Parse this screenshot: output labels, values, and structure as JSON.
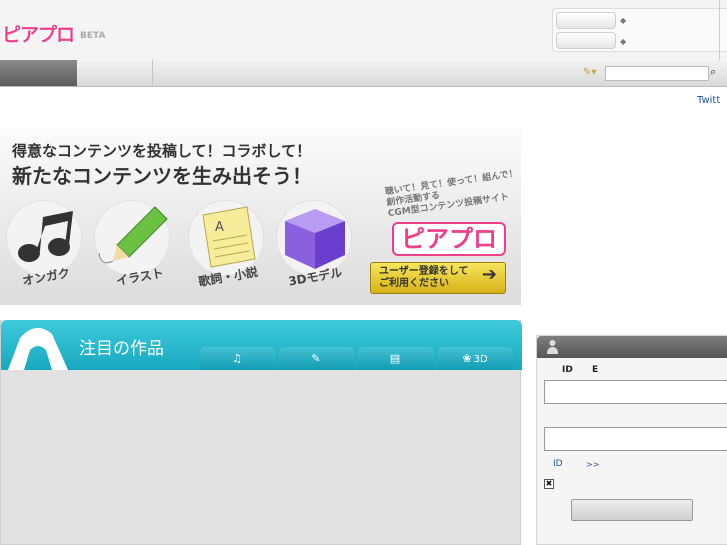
{
  "header": {
    "logo_text": "ピアプロ",
    "beta_label": "BETA",
    "account_buttons": [
      "",
      ""
    ],
    "account_links": [
      "",
      ""
    ]
  },
  "nav": {
    "tabs": [
      "",
      ""
    ],
    "search_option": "",
    "search_placeholder": ""
  },
  "notice": {
    "text": "",
    "twitter_link": "",
    "twitter_tail": "Twitt"
  },
  "banner": {
    "headline_1": "得意なコンテンツを投稿して！コラボして！",
    "headline_2": "新たなコンテンツを生み出そう！",
    "categories": [
      "オンガク",
      "イラスト",
      "歌詞・小説",
      "3Dモデル"
    ],
    "tagline": [
      "聴いて！見て！使って！組んで！",
      "創作活動する",
      "CGM型コンテンツ投稿サイト"
    ],
    "logo_text": "ピアプロ",
    "register_button": [
      "ユーザー登録をして",
      "ご利用ください"
    ]
  },
  "featured": {
    "title": "注目の作品",
    "tabs": [
      {
        "icon": "music-note-icon",
        "glyph": "♫",
        "label": ""
      },
      {
        "icon": "pencil-icon",
        "glyph": "✎",
        "label": ""
      },
      {
        "icon": "document-icon",
        "glyph": "▤",
        "label": ""
      },
      {
        "icon": "cube-icon",
        "glyph": "❀",
        "label": "3D"
      }
    ]
  },
  "login": {
    "id_label": "ID",
    "e_label": "E",
    "id_value": "",
    "password_value": "",
    "forgot_link": "ID",
    "more_link": ">>",
    "checkbox_mark": "✖",
    "submit_label": ""
  },
  "colors": {
    "brand_pink": "#ef3f8a",
    "featured_teal": "#17a8bf",
    "link_blue": "#1a55a5",
    "register_yellow": "#f7e55a"
  }
}
